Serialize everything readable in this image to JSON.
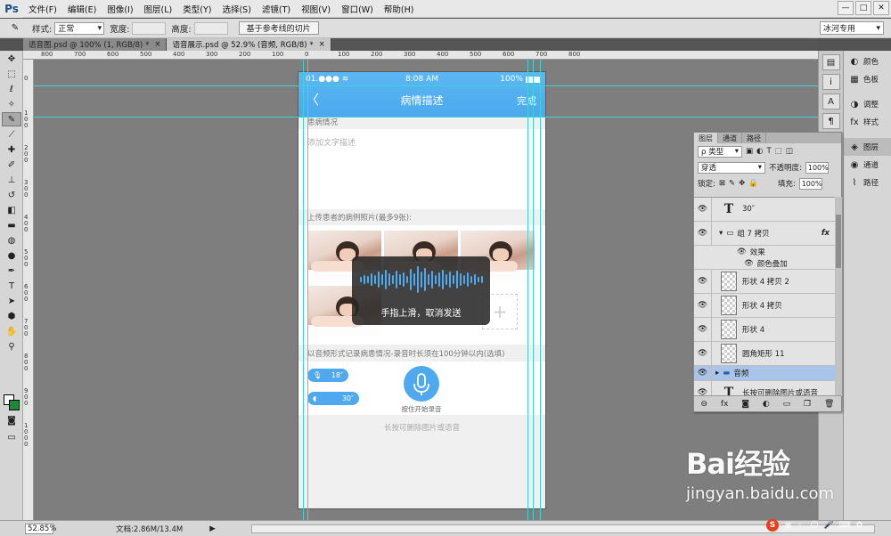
{
  "app": {
    "logo": "Ps"
  },
  "menu": [
    "文件(F)",
    "编辑(E)",
    "图像(I)",
    "图层(L)",
    "类型(Y)",
    "选择(S)",
    "滤镜(T)",
    "视图(V)",
    "窗口(W)",
    "帮助(H)"
  ],
  "window_controls": [
    "—",
    "□",
    "✕"
  ],
  "options": {
    "style_label": "样式:",
    "style_value": "正常",
    "width_label": "宽度:",
    "height_label": "高度:",
    "slice_button": "基于参考线的切片",
    "workspace": "冰河专用"
  },
  "tabs": [
    {
      "label": "语音图.psd @ 100% (1, RGB/8) *",
      "close": "×"
    },
    {
      "label": "语音展示.psd @ 52.9% (音频, RGB/8) *",
      "close": "×"
    }
  ],
  "ruler_top_labels": [
    "800",
    "700",
    "600",
    "500",
    "400",
    "300",
    "200",
    "100",
    "0",
    "100",
    "200",
    "300",
    "400",
    "500",
    "600",
    "700",
    "800"
  ],
  "ruler_left_labels": [
    "0",
    "100",
    "200",
    "300",
    "400",
    "500",
    "600",
    "700",
    "800",
    "900",
    "1000"
  ],
  "phone": {
    "status_time": "8:08 AM",
    "status_battery": "100%",
    "status_signal": "01.●●● ≋",
    "nav_back": "〈",
    "nav_title": "病情描述",
    "nav_done": "完成",
    "section_condition": "患病情况",
    "text_placeholder": "添加文字描述",
    "section_photos": "上传患者的病例照片(最多9张):",
    "add_plus": "+",
    "voice_tip": "手指上滑，取消发送",
    "section_audio": "以音频形式记录病患情况-录音时长须在100分钟以内(选填)",
    "audio_1": "18″",
    "audio_2": "30″",
    "mic_label": "按住开始录音",
    "bottom_tip": "长按可删除图片或语音"
  },
  "layers_panel": {
    "tabs": [
      "图层",
      "通道",
      "路径"
    ],
    "filter_kind": "ρ 类型",
    "blend_mode": "穿透",
    "opacity_label": "不透明度:",
    "opacity_value": "100%",
    "lock_label": "锁定:",
    "fill_label": "填充:",
    "fill_value": "100%",
    "layers": [
      {
        "name": "30″",
        "kind": "text"
      },
      {
        "name": "组 7 拷贝",
        "kind": "group",
        "fx": "fx"
      },
      {
        "name": "效果",
        "kind": "effect"
      },
      {
        "name": "颜色叠加",
        "kind": "effect"
      },
      {
        "name": "形状 4 拷贝 2",
        "kind": "shape"
      },
      {
        "name": "形状 4 拷贝",
        "kind": "shape"
      },
      {
        "name": "形状 4",
        "kind": "shape"
      },
      {
        "name": "圆角矩形 11",
        "kind": "shape"
      },
      {
        "name": "音频",
        "kind": "folder",
        "selected": true
      },
      {
        "name": "长按可删除图片或语音",
        "kind": "text"
      }
    ],
    "footer_icons": [
      "⊖",
      "fx",
      "◙",
      "◐",
      "▭",
      "❐",
      "🗑"
    ]
  },
  "right_panels": [
    {
      "label": "颜色",
      "icon": "◐"
    },
    {
      "label": "色板",
      "icon": "▦"
    },
    {
      "label": "调整",
      "icon": "◑"
    },
    {
      "label": "样式",
      "icon": "fx"
    },
    {
      "label": "图层",
      "icon": "◈"
    },
    {
      "label": "通道",
      "icon": "◉"
    },
    {
      "label": "路径",
      "icon": "⌇"
    }
  ],
  "status": {
    "zoom": "52.85%",
    "doc_info": "文档:2.86M/13.4M"
  },
  "watermark": {
    "logo": "Bai经验",
    "url": "jingyan.baidu.com"
  },
  "ime": {
    "logo": "S",
    "lang": "英"
  }
}
